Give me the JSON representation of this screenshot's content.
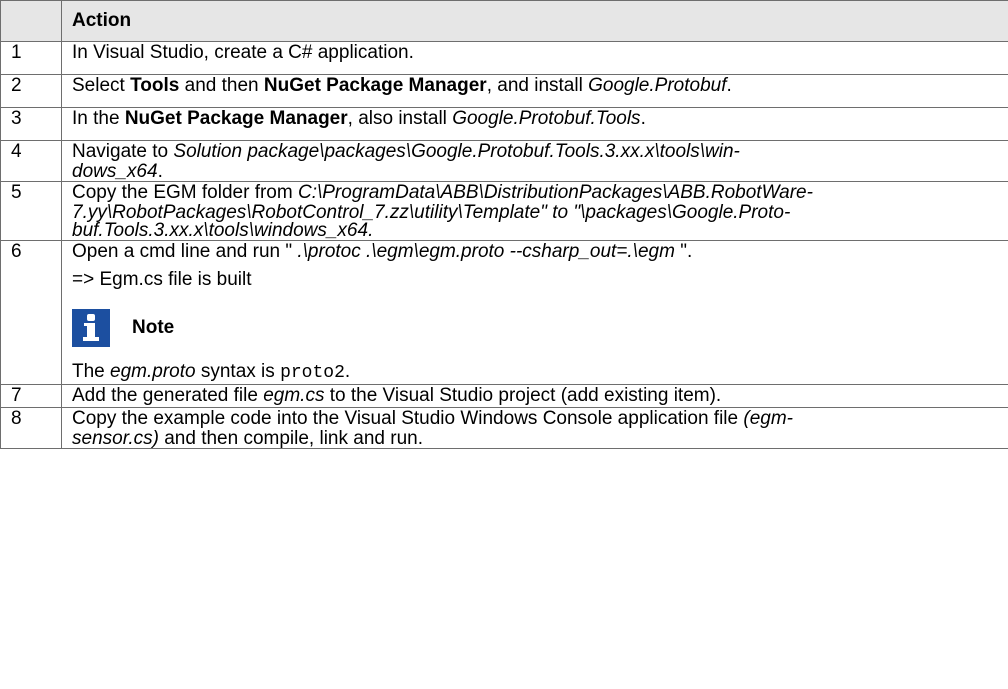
{
  "header": {
    "num": "",
    "action": "Action"
  },
  "rows": [
    {
      "num": "1",
      "text": "In Visual Studio, create a C# application."
    },
    {
      "num": "2",
      "a": "Select ",
      "b": "Tools",
      "c": " and then ",
      "d": "NuGet Package Manager",
      "e": ", and install ",
      "f": "Google.Protobuf",
      "g": "."
    },
    {
      "num": "3",
      "a": "In the ",
      "b": "NuGet Package Manager",
      "c": ", also install ",
      "d": "Google.Protobuf.Tools",
      "e": "."
    },
    {
      "num": "4",
      "a": "Navigate to ",
      "b": "Solution package\\packages\\Google.Protobuf.Tools.3.xx.x\\tools\\win-",
      "c": "dows_x64",
      "d": "."
    },
    {
      "num": "5",
      "a": "Copy the EGM folder from ",
      "b": "C:\\ProgramData\\ABB\\DistributionPackages\\ABB.RobotWare-",
      "c": "7.yy\\RobotPackages\\RobotControl_7.zz\\utility\\Template\" to \"\\packages\\Google.Proto-",
      "d": "buf.Tools.3.xx.x\\tools\\windows_x64."
    },
    {
      "num": "6",
      "a": "Open a cmd line and run \" ",
      "b": ".\\protoc .\\egm\\egm.proto --csharp_out=.\\egm",
      "c": " \".",
      "d": "=> Egm.cs file is built",
      "note_label": "Note",
      "e": "The ",
      "f": "egm.proto",
      "g": " syntax is ",
      "h": "proto2",
      "i": "."
    },
    {
      "num": "7",
      "a": "Add the generated file ",
      "b": "egm.cs",
      "c": " to the Visual Studio project (add existing item)."
    },
    {
      "num": "8",
      "a": "Copy the example code into the Visual Studio Windows Console application file ",
      "b": "(egm-",
      "c": "sensor.cs)",
      "d": " and then compile, link and run."
    }
  ],
  "icons": {
    "note": "info-icon"
  },
  "colors": {
    "header_bg": "#e6e6e6",
    "border": "#6e6e6e",
    "note_icon": "#1c4fa0"
  }
}
